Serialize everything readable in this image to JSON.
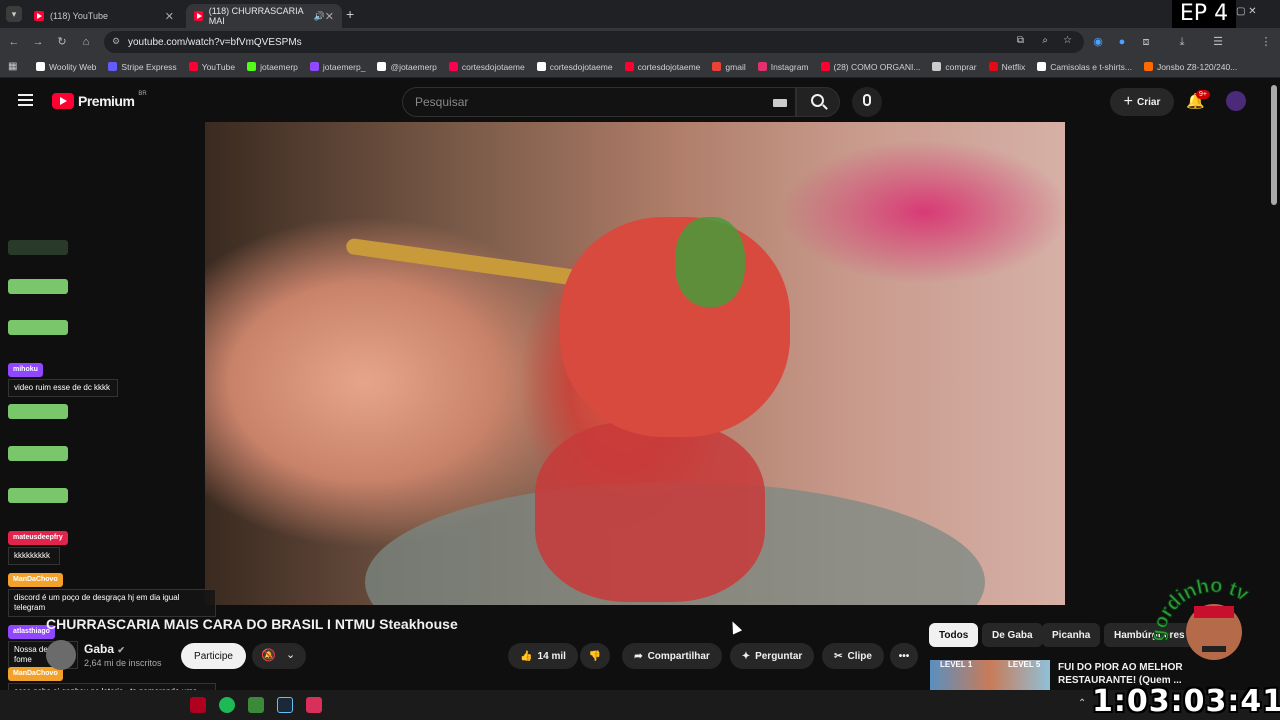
{
  "browser": {
    "tabs": [
      {
        "label": "(118) YouTube"
      },
      {
        "label": "(118) CHURRASCARIA MAI"
      }
    ],
    "url": "youtube.com/watch?v=bfVmQVESPMs",
    "bookmarks": [
      {
        "label": "Woolity Web",
        "color": "#ffffff"
      },
      {
        "label": "Stripe Express",
        "color": "#635bff"
      },
      {
        "label": "YouTube",
        "color": "#ff0033"
      },
      {
        "label": "jotaemerp",
        "color": "#53fc18"
      },
      {
        "label": "jotaemerp_",
        "color": "#9146ff"
      },
      {
        "label": "@jotaemerp",
        "color": "#ffffff"
      },
      {
        "label": "cortesdojotaeme",
        "color": "#ff0050"
      },
      {
        "label": "cortesdojotaeme",
        "color": "#ffffff"
      },
      {
        "label": "cortesdojotaeme",
        "color": "#ff0033"
      },
      {
        "label": "gmail",
        "color": "#ea4335"
      },
      {
        "label": "Instagram",
        "color": "#e1306c"
      },
      {
        "label": "(28) COMO ORGANI...",
        "color": "#ff0033"
      },
      {
        "label": "comprar",
        "color": "#cccccc"
      },
      {
        "label": "Netflix",
        "color": "#e50914"
      },
      {
        "label": "Camisolas e t-shirts...",
        "color": "#ffffff"
      },
      {
        "label": "Jonsbo Z8-120/240...",
        "color": "#ff6a00"
      }
    ]
  },
  "youtube": {
    "logo_text": "Premium",
    "logo_badge": "BR",
    "search_placeholder": "Pesquisar",
    "create_label": "Criar",
    "notif_count": "9+"
  },
  "video": {
    "title": "CHURRASCARIA MAIS CARA DO BRASIL I NTMU Steakhouse",
    "channel": "Gaba",
    "subscribers": "2,64 mi de inscritos",
    "join_label": "Participe",
    "likes": "14 mil",
    "share_label": "Compartilhar",
    "ask_label": "Perguntar",
    "clip_label": "Clipe"
  },
  "filters": [
    "Todos",
    "De Gaba",
    "Picanha",
    "Hambúrgueres"
  ],
  "recommendation": {
    "title": "FUI DO PIOR AO MELHOR RESTAURANTE! (Quem ...",
    "thumb_labels": [
      "LEVEL 1",
      "LEVEL 5"
    ]
  },
  "chat": [
    {
      "user": "mihoku",
      "user_color": "#9146ff",
      "text": "video ruim esse de dc kkkk"
    },
    {
      "user": "mateusdeepfry",
      "user_color": "#e0244c",
      "text": "kkkkkkkkk"
    },
    {
      "user": "ManDaChovo",
      "user_color": "#f2a22b",
      "text": "discord é um poço de desgraça hj em dia igual telegram"
    },
    {
      "user": "atlasthiago",
      "user_color": "#9146ff",
      "text": "Nossa deu fome"
    },
    {
      "user": "ManDaChovo",
      "user_color": "#f2a22b",
      "text": "esse gaba ai ganhou na loteria.. ta namorando uma campeã do masterchef mto massa a guria.."
    }
  ],
  "overlay": {
    "episode": "EP 4",
    "timer": "1:03:03:41",
    "streamer_logo_text": "gordinho tv"
  }
}
